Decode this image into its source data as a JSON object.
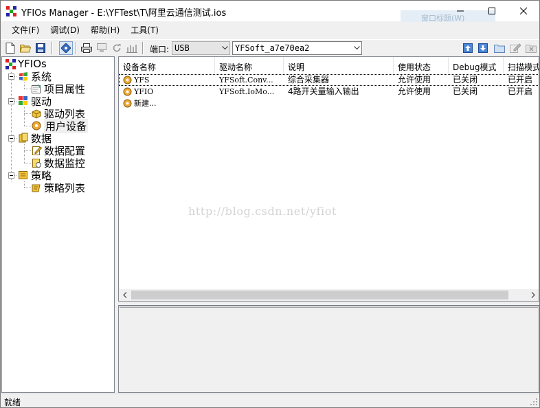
{
  "window": {
    "title": "YFIOs Manager - E:\\YFTest\\T\\阿里云通信测试.ios",
    "ghost_tooltip": "窗口标题(W)"
  },
  "menu": [
    "文件(F)",
    "调试(D)",
    "帮助(H)",
    "工具(T)"
  ],
  "toolbar": {
    "port_label": "端口:",
    "port_value": "USB",
    "device_value": "YFSoft_a7e70ea2",
    "buttons": [
      "new-file-icon",
      "open-folder-icon",
      "save-icon",
      "connect-icon",
      "printer-icon",
      "monitor-icon",
      "refresh-icon",
      "chart-icon",
      "upload-icon",
      "download-icon",
      "folder-icon",
      "edit-icon",
      "delete-icon"
    ]
  },
  "tree": {
    "root": "YFIOs",
    "nodes": [
      {
        "label": "系统",
        "children": [
          "项目属性"
        ]
      },
      {
        "label": "驱动",
        "children": [
          "驱动列表",
          "用户设备"
        ]
      },
      {
        "label": "数据",
        "children": [
          "数据配置",
          "数据监控"
        ]
      },
      {
        "label": "策略",
        "children": [
          "策略列表"
        ]
      }
    ]
  },
  "list": {
    "columns": [
      "设备名称",
      "驱动名称",
      "说明",
      "使用状态",
      "Debug模式",
      "扫描模式"
    ],
    "rows": [
      [
        "YFS",
        "YFSoft.Conv...",
        "综合采集器",
        "允许使用",
        "已关闭",
        "已开启"
      ],
      [
        "YFIO",
        "YFSoft.IoMo...",
        "4路开关量输入输出",
        "允许使用",
        "已关闭",
        "已开启"
      ]
    ],
    "new_item": "新建..."
  },
  "watermark": "http://blog.csdn.net/yfiot",
  "status": {
    "text": "就绪"
  }
}
